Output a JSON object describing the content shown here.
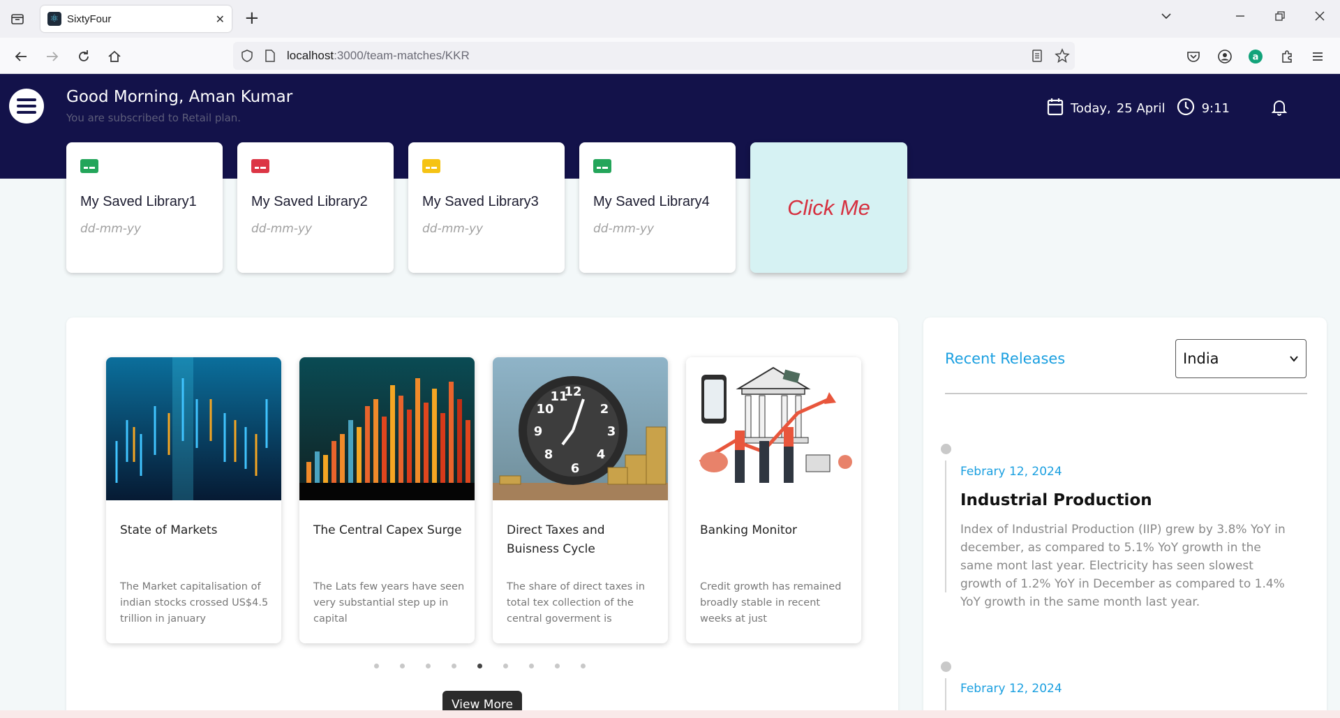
{
  "browser": {
    "tab_title": "SixtyFour",
    "url_host": "localhost",
    "url_path": ":3000/team-matches/KKR"
  },
  "header": {
    "greeting": "Good Morning, Aman Kumar",
    "subtitle": "You are subscribed to Retail plan.",
    "date_label": "Today,",
    "date_value": "25 April",
    "time": "9:11"
  },
  "library_cards": [
    {
      "title": "My Saved Library1",
      "date": "dd-mm-yy",
      "color": "#23a55a"
    },
    {
      "title": "My Saved Library2",
      "date": "dd-mm-yy",
      "color": "#dc3545"
    },
    {
      "title": "My Saved Library3",
      "date": "dd-mm-yy",
      "color": "#f5c314"
    },
    {
      "title": "My Saved Library4",
      "date": "dd-mm-yy",
      "color": "#23a55a"
    }
  ],
  "click_card": {
    "label": "Click Me"
  },
  "reports": [
    {
      "title": "State of Markets",
      "desc": "The Market capitalisation of indian stocks crossed US$4.5 trillion in january"
    },
    {
      "title": "The Central Capex Surge",
      "desc": "The Lats few years have seen very substantial step up in capital"
    },
    {
      "title": "Direct Taxes and Buisness Cycle",
      "desc": "The share of direct taxes in total tex collection of the central goverment is"
    },
    {
      "title": "Banking Monitor",
      "desc": "Credit growth has remained broadly stable in recent weeks at just"
    }
  ],
  "carousel": {
    "active_index": 4,
    "count": 9
  },
  "view_more": "View More",
  "releases": {
    "title": "Recent Releases",
    "country": "India",
    "items": [
      {
        "date": "Febrary 12, 2024",
        "title": "Industrial Production",
        "desc": "Index of Industrial Production (IIP) grew by 3.8% YoY in december, as compared to 5.1% YoY growth in the same mont last year. Electricity has seen slowest growth of 1.2% YoY in December as compared to 1.4% YoY growth in the same month last year."
      },
      {
        "date": "Febrary 12, 2024"
      }
    ]
  },
  "colors": {
    "header_bg": "#13124a",
    "accent_blue": "#1a9fe0",
    "click_me_text": "#d6303f",
    "click_me_bg": "#d6f2f3"
  }
}
